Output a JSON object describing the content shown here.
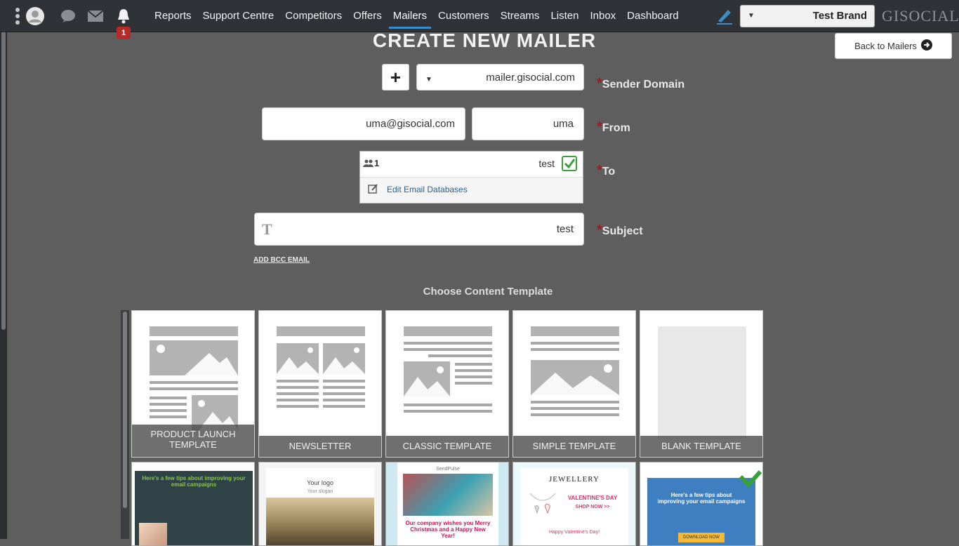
{
  "brand": {
    "logo_text": "GISOCIAL",
    "selected": "Test Brand"
  },
  "nav": {
    "items": [
      {
        "label": "Reports"
      },
      {
        "label": "Support Centre"
      },
      {
        "label": "Competitors"
      },
      {
        "label": "Offers"
      },
      {
        "label": "Mailers"
      },
      {
        "label": "Customers"
      },
      {
        "label": "Streams"
      },
      {
        "label": "Listen"
      },
      {
        "label": "Inbox"
      },
      {
        "label": "Dashboard"
      }
    ],
    "active": "Mailers",
    "notification_count": "1"
  },
  "page": {
    "title": "CREATE NEW MAILER",
    "back_label": "Back to Mailers"
  },
  "form": {
    "sender_domain_label": "Sender Domain",
    "sender_domain_value": "mailer.gisocial.com",
    "add_domain_label": "+",
    "from_label": "From",
    "from_name": "uma",
    "from_email": "uma@gisocial.com",
    "to_label": "To",
    "to_list_name": "test",
    "to_list_count": "1",
    "edit_db_label": "Edit Email Databases",
    "subject_label": "Subject",
    "subject_value": "test",
    "add_bcc_label": "ADD BCC EMAIL",
    "required_mark": "*"
  },
  "templates": {
    "section_title": "Choose Content Template",
    "row1": [
      {
        "label": "BLANK TEMPLATE"
      },
      {
        "label": "SIMPLE TEMPLATE"
      },
      {
        "label": "CLASSIC TEMPLATE"
      },
      {
        "label": "NEWSLETTER"
      },
      {
        "label": "PRODUCT LAUNCH TEMPLATE"
      }
    ],
    "row2": [
      {
        "header": "Here's a few tips about improving your email campaigns",
        "button": "DOWNLOAD NOW"
      },
      {
        "brand": "JEWELLERY",
        "headline": "VALENTINE'S DAY",
        "cta": "SHOP NOW >>",
        "footer": "Happy Valentine's Day!"
      },
      {
        "brand": "SendPulse",
        "headline": "Our company wishes you Merry Christmas and a Happy New Year!"
      },
      {
        "top": "Your logo",
        "sub": "Your slogan"
      },
      {
        "header": "Here's a few tips about improving your email campaigns"
      }
    ]
  },
  "colors": {
    "accent": "#3b8ec9",
    "required": "#9b1d1d",
    "selected_check": "#3aa13a"
  }
}
